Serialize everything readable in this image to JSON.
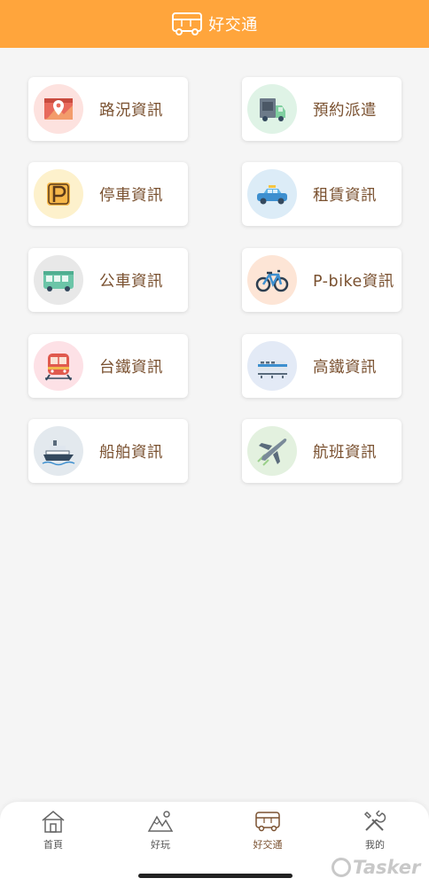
{
  "header": {
    "title": "好交通",
    "icon": "bus-icon"
  },
  "tiles": [
    {
      "label": "路況資訊",
      "icon": "map-pin-icon",
      "bg": "#fde2df"
    },
    {
      "label": "預約派遣",
      "icon": "truck-icon",
      "bg": "#dff3e6"
    },
    {
      "label": "停車資訊",
      "icon": "parking-icon",
      "bg": "#fdf1cc"
    },
    {
      "label": "租賃資訊",
      "icon": "taxi-icon",
      "bg": "#dcecf7"
    },
    {
      "label": "公車資訊",
      "icon": "bus-icon",
      "bg": "#e8e8e8"
    },
    {
      "label": "P-bike資訊",
      "icon": "bicycle-icon",
      "bg": "#fde5d6"
    },
    {
      "label": "台鐵資訊",
      "icon": "train-icon",
      "bg": "#fde1e6"
    },
    {
      "label": "高鐵資訊",
      "icon": "high-speed-rail-icon",
      "bg": "#e3eaf6"
    },
    {
      "label": "船舶資訊",
      "icon": "ship-icon",
      "bg": "#e3e9ee"
    },
    {
      "label": "航班資訊",
      "icon": "airplane-icon",
      "bg": "#e3f1df"
    }
  ],
  "tabbar": [
    {
      "label": "首頁",
      "icon": "house-icon",
      "active": false
    },
    {
      "label": "好玩",
      "icon": "mountain-icon",
      "active": false
    },
    {
      "label": "好交通",
      "icon": "bus-icon",
      "active": true
    },
    {
      "label": "我的",
      "icon": "tools-icon",
      "active": false
    }
  ],
  "watermark": "Tasker",
  "colors": {
    "header": "#ffa53c",
    "tile_text": "#7a5130",
    "background": "#f5f5f5"
  }
}
